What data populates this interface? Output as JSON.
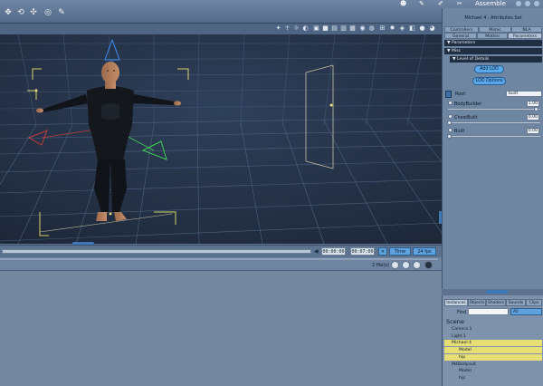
{
  "app": {
    "mode_label": "Assemble",
    "mode_icons": [
      "figure-icon",
      "wrench-icon",
      "paint-icon",
      "gear-icon"
    ]
  },
  "toolbar": {
    "tools": [
      {
        "name": "move-tool-icon",
        "glyph": "✥"
      },
      {
        "name": "rotate-tool-icon",
        "glyph": "⟲"
      },
      {
        "name": "scale-tool-icon",
        "glyph": "✣"
      },
      {
        "name": "target-tool-icon",
        "glyph": "◎"
      },
      {
        "name": "pin-tool-icon",
        "glyph": "✎"
      }
    ]
  },
  "timeline": {
    "time_start": "00:00:00",
    "time_end": "00:07:00",
    "mode": "Time",
    "fps": "24 fps"
  },
  "lower_panel": {
    "file_count": "2 file(s)"
  },
  "attributes": {
    "title": "Michael 4 : Attributes Set",
    "tabs_top": [
      "Controllers",
      "Mimic",
      "NLA"
    ],
    "tabs_bottom": [
      "General",
      "Motion",
      "Parameters"
    ],
    "active_tab": "Parameters",
    "sections": {
      "parameters": "Parameters",
      "misc": "Misc",
      "lod": "Level of Details"
    },
    "buttons": {
      "add_lod": "Add LOD",
      "lod_options": "LOD Options"
    },
    "root": {
      "label": "Root",
      "value": "built"
    },
    "params": [
      {
        "label": "BodyBuilder",
        "value": "1.00",
        "knob": 0.97
      },
      {
        "label": "ChestBuilt",
        "value": "0.00",
        "knob": 0.0
      },
      {
        "label": "Built",
        "value": "0.00",
        "knob": 0.0
      }
    ]
  },
  "scene_tree": {
    "tabs": [
      "Instances",
      "Objects",
      "Shaders",
      "Sounds",
      "Clips"
    ],
    "active_tab": "Instances",
    "find_label": "Find",
    "find_value": "",
    "filter": "All",
    "heading": "Scene",
    "items": [
      {
        "label": "Camera 1",
        "indent": 1,
        "selected": false
      },
      {
        "label": "Light 1",
        "indent": 1,
        "selected": false
      },
      {
        "label": "Michael 4",
        "indent": 1,
        "selected": true
      },
      {
        "label": "Model",
        "indent": 2,
        "selected": true
      },
      {
        "label": "hip",
        "indent": 2,
        "selected": true
      },
      {
        "label": "M4Bodysuit",
        "indent": 1,
        "selected": false
      },
      {
        "label": "Model",
        "indent": 2,
        "selected": false
      },
      {
        "label": "hip",
        "indent": 2,
        "selected": false
      }
    ]
  }
}
